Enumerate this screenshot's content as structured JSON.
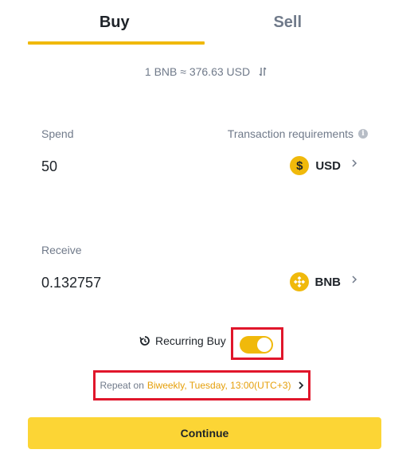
{
  "tabs": {
    "buy": "Buy",
    "sell": "Sell",
    "active": "Buy"
  },
  "rate": {
    "text": "1 BNB ≈ 376.63 USD"
  },
  "spend": {
    "label": "Spend",
    "requirements": "Transaction requirements",
    "amount": "50",
    "currency": "USD",
    "currency_icon": "usd-coin-icon"
  },
  "receive": {
    "label": "Receive",
    "amount": "0.132757",
    "currency": "BNB",
    "currency_icon": "bnb-coin-icon"
  },
  "recurring": {
    "label": "Recurring Buy",
    "enabled": true
  },
  "repeat": {
    "label": "Repeat on",
    "value": "Biweekly, Tuesday, 13:00(UTC+3)"
  },
  "continue_label": "Continue",
  "colors": {
    "accent": "#f0b90b",
    "button": "#fcd535",
    "highlight_box": "#e0162b",
    "repeat_value": "#e59f0a"
  }
}
